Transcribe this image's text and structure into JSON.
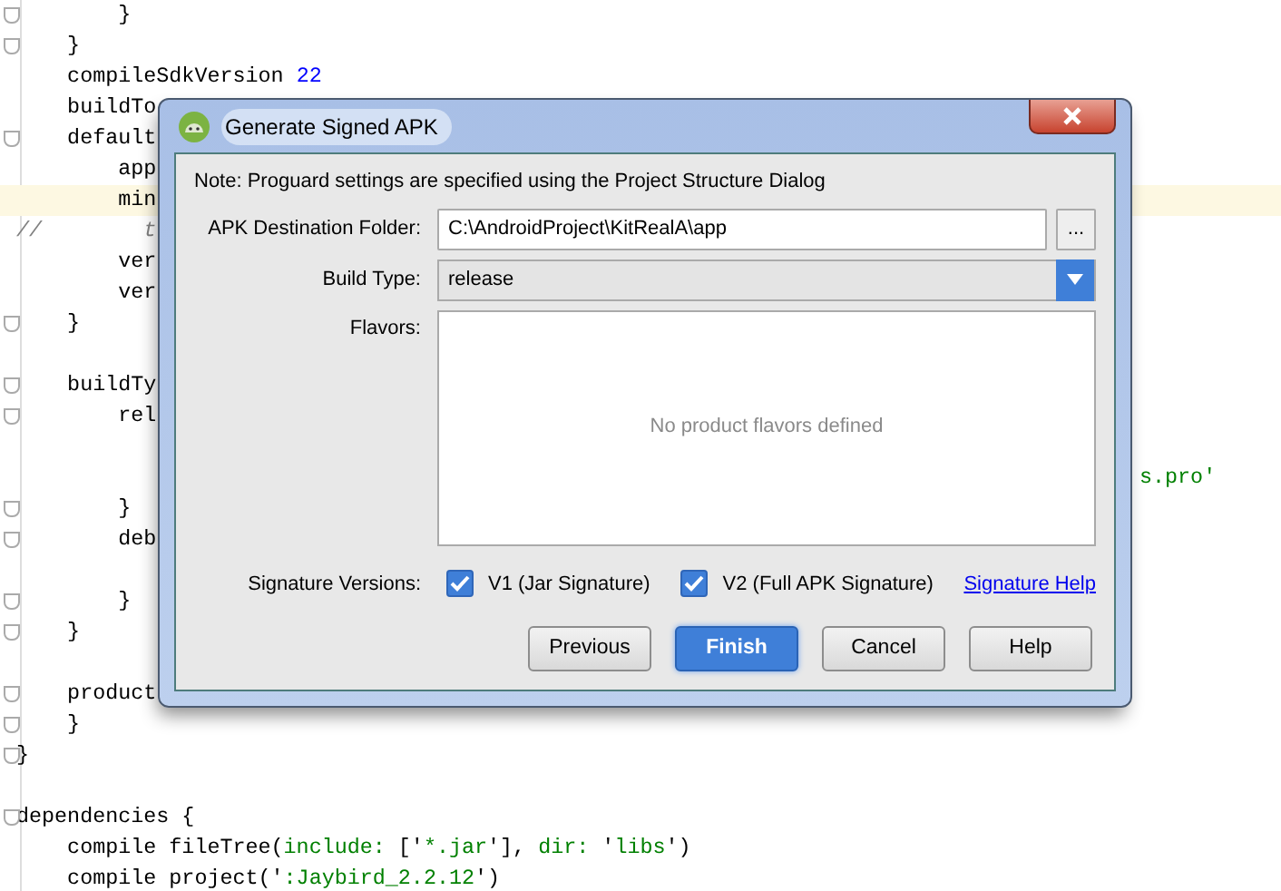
{
  "editor": {
    "lines": [
      {
        "fold": true,
        "highlighted": false,
        "segments": [
          {
            "kind": "plain",
            "text": "        }"
          }
        ]
      },
      {
        "fold": true,
        "highlighted": false,
        "segments": [
          {
            "kind": "plain",
            "text": "    }"
          }
        ]
      },
      {
        "fold": false,
        "highlighted": false,
        "segments": [
          {
            "kind": "plain",
            "text": "    compileSdkVersion "
          },
          {
            "kind": "number",
            "text": "22"
          }
        ]
      },
      {
        "fold": false,
        "highlighted": false,
        "segments": [
          {
            "kind": "plain",
            "text": "    buildTo"
          }
        ]
      },
      {
        "fold": true,
        "highlighted": false,
        "segments": [
          {
            "kind": "plain",
            "text": "    default"
          }
        ]
      },
      {
        "fold": false,
        "highlighted": false,
        "segments": [
          {
            "kind": "plain",
            "text": "        app"
          }
        ]
      },
      {
        "fold": false,
        "highlighted": true,
        "segments": [
          {
            "kind": "plain",
            "text": "        min"
          }
        ]
      },
      {
        "fold": false,
        "highlighted": false,
        "segments": [
          {
            "kind": "comment",
            "text": "//        t"
          }
        ]
      },
      {
        "fold": false,
        "highlighted": false,
        "segments": [
          {
            "kind": "plain",
            "text": "        ver"
          }
        ]
      },
      {
        "fold": false,
        "highlighted": false,
        "segments": [
          {
            "kind": "plain",
            "text": "        ver"
          }
        ]
      },
      {
        "fold": true,
        "highlighted": false,
        "segments": [
          {
            "kind": "plain",
            "text": "    }"
          }
        ]
      },
      {
        "fold": false,
        "highlighted": false
      },
      {
        "fold": true,
        "highlighted": false,
        "segments": [
          {
            "kind": "plain",
            "text": "    buildTy"
          }
        ]
      },
      {
        "fold": true,
        "highlighted": false,
        "segments": [
          {
            "kind": "plain",
            "text": "        rel"
          }
        ]
      },
      {
        "fold": false,
        "highlighted": false
      },
      {
        "fold": false,
        "highlighted": false,
        "right_segments": [
          {
            "kind": "string",
            "text": "s.pro'"
          }
        ]
      },
      {
        "fold": true,
        "highlighted": false,
        "segments": [
          {
            "kind": "plain",
            "text": "        }"
          }
        ]
      },
      {
        "fold": true,
        "highlighted": false,
        "segments": [
          {
            "kind": "plain",
            "text": "        deb"
          }
        ]
      },
      {
        "fold": false,
        "highlighted": false
      },
      {
        "fold": true,
        "highlighted": false,
        "segments": [
          {
            "kind": "plain",
            "text": "        }"
          }
        ]
      },
      {
        "fold": true,
        "highlighted": false,
        "segments": [
          {
            "kind": "plain",
            "text": "    }"
          }
        ]
      },
      {
        "fold": false,
        "highlighted": false
      },
      {
        "fold": true,
        "highlighted": false,
        "segments": [
          {
            "kind": "plain",
            "text": "    product"
          }
        ]
      },
      {
        "fold": true,
        "highlighted": false,
        "segments": [
          {
            "kind": "plain",
            "text": "    }"
          }
        ]
      },
      {
        "fold": true,
        "highlighted": false,
        "segments": [
          {
            "kind": "plain",
            "text": "}"
          }
        ]
      },
      {
        "fold": false,
        "highlighted": false
      },
      {
        "fold": true,
        "highlighted": false,
        "segments": [
          {
            "kind": "plain",
            "text": "dependencies {"
          }
        ]
      },
      {
        "fold": false,
        "highlighted": false,
        "segments": [
          {
            "kind": "plain",
            "text": "    compile fileTree("
          },
          {
            "kind": "string",
            "text": "include:"
          },
          {
            "kind": "plain",
            "text": " ['"
          },
          {
            "kind": "string",
            "text": "*.jar"
          },
          {
            "kind": "plain",
            "text": "'], "
          },
          {
            "kind": "string",
            "text": "dir:"
          },
          {
            "kind": "plain",
            "text": " '"
          },
          {
            "kind": "string",
            "text": "libs"
          },
          {
            "kind": "plain",
            "text": "')"
          }
        ]
      },
      {
        "fold": false,
        "highlighted": false,
        "segments": [
          {
            "kind": "plain",
            "text": "    compile project('"
          },
          {
            "kind": "string",
            "text": ":Jaybird_2.2.12"
          },
          {
            "kind": "plain",
            "text": "')"
          }
        ]
      }
    ]
  },
  "dialog": {
    "title": "Generate Signed APK",
    "note": "Note: Proguard settings are specified using the Project Structure Dialog",
    "destination": {
      "label": "APK Destination Folder:",
      "value": "C:\\AndroidProject\\KitRealA\\app",
      "browse": "..."
    },
    "build_type": {
      "label": "Build Type:",
      "value": "release"
    },
    "flavors": {
      "label": "Flavors:",
      "empty_text": "No product flavors defined"
    },
    "signature": {
      "label": "Signature Versions:",
      "options": [
        {
          "label": "V1 (Jar Signature)",
          "checked": true
        },
        {
          "label": "V2 (Full APK Signature)",
          "checked": true
        }
      ],
      "help_link": "Signature Help"
    },
    "buttons": [
      {
        "label": "Previous",
        "primary": false
      },
      {
        "label": "Finish",
        "primary": true
      },
      {
        "label": "Cancel",
        "primary": false
      },
      {
        "label": "Help",
        "primary": false
      }
    ]
  }
}
